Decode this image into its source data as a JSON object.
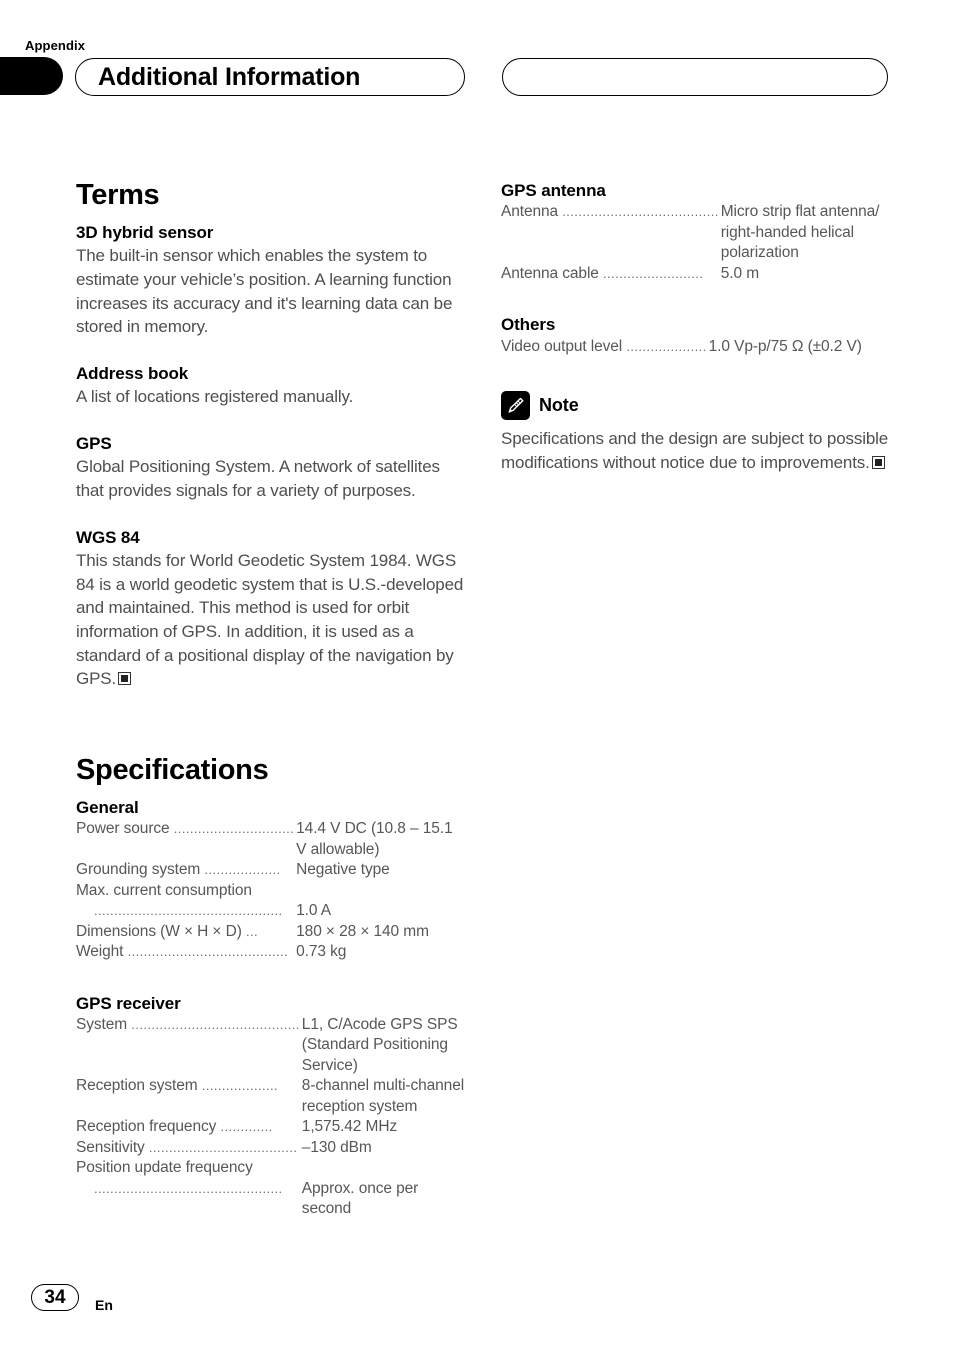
{
  "header": {
    "appendix_label": "Appendix",
    "title": "Additional Information"
  },
  "footer": {
    "page_number": "34",
    "language_code": "En"
  },
  "left_column": {
    "terms_section": {
      "heading": "Terms",
      "entries": [
        {
          "term": "3D hybrid sensor",
          "definition": "The built-in sensor which enables the system to estimate your vehicle’s position. A learning function increases its accuracy and it's learning data can be stored in memory."
        },
        {
          "term": "Address book",
          "definition": "A list of locations registered manually."
        },
        {
          "term": "GPS",
          "definition": "Global Positioning System. A network of satellites that provides signals for a variety of purposes."
        },
        {
          "term": "WGS 84",
          "definition": "This stands for World Geodetic System 1984. WGS 84 is a world geodetic system that is U.S.-developed and maintained. This method is used for orbit information of GPS. In addition, it is used as a standard of a positional display of the navigation by GPS."
        }
      ]
    },
    "specifications_section": {
      "heading": "Specifications",
      "groups": [
        {
          "title": "General",
          "rows": [
            {
              "label": "Power source",
              "leader": "..............................",
              "value": "14.4 V DC (10.8 – 15.1 V allowable)",
              "style": "inline"
            },
            {
              "label": "Grounding system",
              "leader": "...................",
              "value": "Negative type",
              "style": "inline"
            },
            {
              "label": "Max. current consumption",
              "leader": "...............................................",
              "value": "1.0 A",
              "style": "wrapped"
            },
            {
              "label": "Dimensions (W × H × D)",
              "leader": "...",
              "value": "180 × 28 × 140 mm",
              "style": "inline"
            },
            {
              "label": "Weight",
              "leader": "........................................",
              "value": "0.73 kg",
              "style": "inline"
            }
          ]
        },
        {
          "title": "GPS receiver",
          "rows": [
            {
              "label": "System",
              "leader": "..........................................",
              "value": "L1, C/Acode GPS SPS (Standard Positioning Service)",
              "style": "inline"
            },
            {
              "label": "Reception system",
              "leader": "...................",
              "value": "8-channel multi-channel reception system",
              "style": "inline"
            },
            {
              "label": "Reception frequency",
              "leader": ".............",
              "value": "1,575.42 MHz",
              "style": "inline"
            },
            {
              "label": "Sensitivity",
              "leader": ".....................................",
              "value": "–130 dBm",
              "style": "inline"
            },
            {
              "label": "Position update frequency",
              "leader": "...............................................",
              "value": "Approx. once per second",
              "style": "wrapped"
            }
          ]
        }
      ]
    }
  },
  "right_column": {
    "groups": [
      {
        "title": "GPS antenna",
        "rows": [
          {
            "label": "Antenna",
            "leader": ".......................................",
            "value": "Micro strip flat antenna/ right-handed helical polarization",
            "style": "inline"
          },
          {
            "label": "Antenna cable",
            "leader": ".........................",
            "value": "5.0 m",
            "style": "inline"
          }
        ]
      },
      {
        "title": "Others",
        "rows": [
          {
            "label": "Video output level",
            "leader": "....................",
            "value": "1.0 Vp-p/75 Ω (±0.2 V)",
            "style": "inline"
          }
        ]
      }
    ],
    "note": {
      "icon": "pencil-note-icon",
      "label": "Note",
      "body": "Specifications and the design are subject to possible modifications without notice due to improvements."
    }
  }
}
